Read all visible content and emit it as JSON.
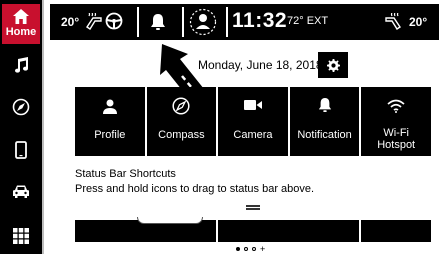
{
  "sidebar": {
    "home_label": "Home",
    "items": [
      {
        "name": "music-icon"
      },
      {
        "name": "compass-icon"
      },
      {
        "name": "phone-icon"
      },
      {
        "name": "car-icon"
      },
      {
        "name": "apps-grid-icon"
      }
    ]
  },
  "statusbar": {
    "driver_temp": "20°",
    "passenger_temp": "20°",
    "time": "11:32",
    "exterior_temp": "72° EXT",
    "icons": [
      "heated-steering-icon",
      "heated-seat-icon",
      "notification-bell-icon",
      "user-profile-icon",
      "heated-seat-passenger-icon"
    ]
  },
  "date_row": {
    "date": "Monday, June 18, 2018"
  },
  "tiles": [
    {
      "label": "Profile",
      "icon": "person-icon"
    },
    {
      "label": "Compass",
      "icon": "compass-icon"
    },
    {
      "label": "Camera",
      "icon": "camera-icon"
    },
    {
      "label": "Notification",
      "icon": "bell-icon"
    },
    {
      "label": "Wi-Fi\nHotspot",
      "icon": "wifi-icon"
    }
  ],
  "shortcuts": {
    "title": "Status Bar Shortcuts",
    "help": "Press and hold icons to drag to status bar above."
  },
  "colors": {
    "accent": "#c8102e",
    "tile_bg": "#000000",
    "text": "#000000"
  }
}
